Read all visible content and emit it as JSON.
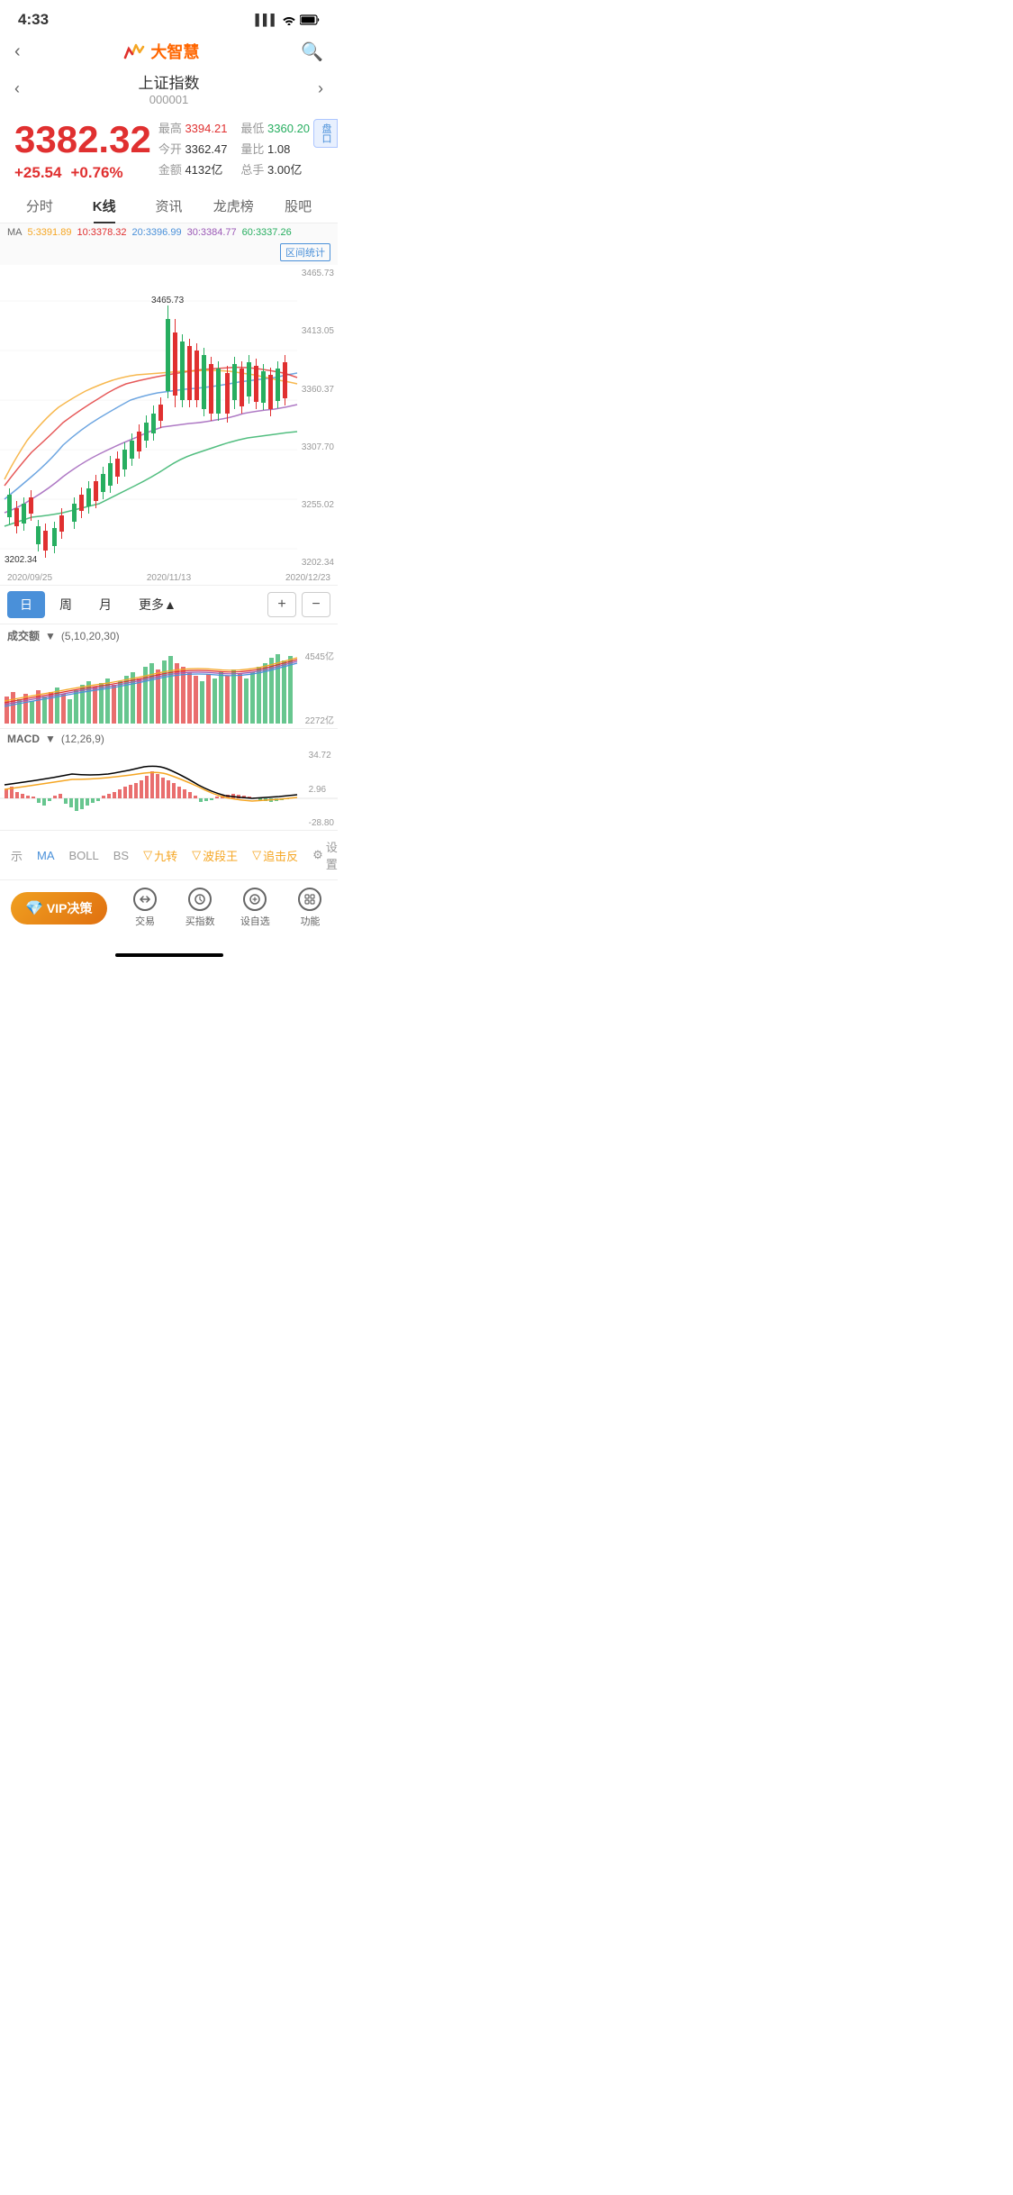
{
  "statusBar": {
    "time": "4:33",
    "signal": "▌▌▌",
    "wifi": "WiFi",
    "battery": "▮"
  },
  "appName": "大智慧",
  "stockName": "上证指数",
  "stockCode": "000001",
  "price": {
    "main": "3382.32",
    "change": "+25.54",
    "changePct": "+0.76%",
    "high": "3394.21",
    "low": "3360.20",
    "open": "3362.47",
    "volRatio": "1.08",
    "amount": "4132亿",
    "totalHand": "3.00亿"
  },
  "tabs": [
    "分时",
    "K线",
    "资讯",
    "龙虎榜",
    "股吧"
  ],
  "activeTab": "K线",
  "ma": {
    "label": "MA",
    "ma5": {
      "period": "5",
      "value": "3391.89",
      "color": "#f5a623"
    },
    "ma10": {
      "period": "10",
      "value": "3378.32",
      "color": "#e03030"
    },
    "ma20": {
      "period": "20",
      "value": "3396.99",
      "color": "#4a90d9"
    },
    "ma30": {
      "period": "30",
      "value": "3384.77",
      "color": "#9b59b6"
    },
    "ma60": {
      "period": "60",
      "value": "3337.26",
      "color": "#27ae60"
    },
    "stat": "区间统计"
  },
  "chartLabels": {
    "high": "3465.73",
    "low": "3202.34",
    "y1": "3465.73",
    "y2": "3413.05",
    "y3": "3360.37",
    "y4": "3307.70",
    "y5": "3255.02",
    "y6": "3202.34"
  },
  "timeAxis": [
    "2020/09/25",
    "2020/11/13",
    "2020/12/23"
  ],
  "periods": [
    "日",
    "周",
    "月",
    "更多▲"
  ],
  "activePeriod": "日",
  "panelBtn": "盘口",
  "volHeader": {
    "label": "成交额",
    "dropdown": "▼",
    "params": "(5,10,20,30)",
    "y1": "4545亿",
    "y2": "2272亿"
  },
  "macdHeader": {
    "label": "MACD",
    "dropdown": "▼",
    "params": "(12,26,9)",
    "y1": "34.72",
    "y2": "2.96",
    "y3": "-28.80"
  },
  "indicators": [
    "示",
    "MA",
    "BOLL",
    "BS",
    "九转",
    "波段王",
    "追击反"
  ],
  "settings": "设置",
  "bottomNav": {
    "vip": "VIP决策",
    "items": [
      "交易",
      "买指数",
      "设自选",
      "功能"
    ]
  }
}
